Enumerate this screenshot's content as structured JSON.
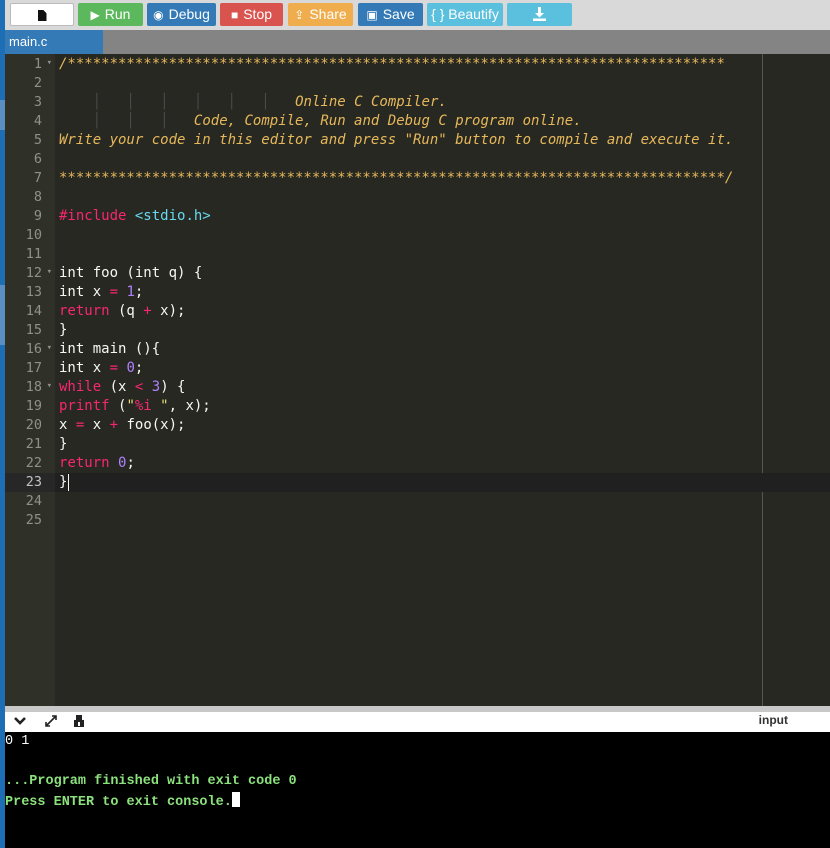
{
  "toolbar": {
    "run_label": "Run",
    "debug_label": "Debug",
    "stop_label": "Stop",
    "share_label": "Share",
    "save_label": "Save",
    "beautify_label": "{ } Beautify",
    "icons": {
      "new": "file-icon",
      "run": "play-icon",
      "debug": "debug-icon",
      "stop": "stop-icon",
      "share": "share-icon",
      "save": "floppy-icon",
      "download": "download-icon"
    }
  },
  "tabs": [
    {
      "label": "main.c",
      "active": true
    }
  ],
  "editor": {
    "line_numbers": [
      "1",
      "2",
      "3",
      "4",
      "5",
      "6",
      "7",
      "8",
      "9",
      "10",
      "11",
      "12",
      "13",
      "14",
      "15",
      "16",
      "17",
      "18",
      "19",
      "20",
      "21",
      "22",
      "23",
      "24",
      "25"
    ],
    "fold_lines": [
      "1",
      "12",
      "16",
      "18"
    ],
    "active_line": "23",
    "lines": [
      "/******************************************************************************",
      "",
      "                            Online C Compiler.",
      "                Code, Compile, Run and Debug C program online.",
      "Write your code in this editor and press \"Run\" button to compile and execute it.",
      "",
      "*******************************************************************************/",
      "",
      "#include <stdio.h>",
      "",
      "",
      "int foo (int q) {",
      "int x = 1;",
      "return (q + x);",
      "}",
      "int main (){",
      "int x = 0;",
      "while (x < 3) {",
      "printf (\"%i \", x);",
      "x = x + foo(x);",
      "}",
      "return 0;",
      "}",
      "",
      ""
    ]
  },
  "console": {
    "input_label": "input",
    "output_line": "0 1",
    "finish_line": "...Program finished with exit code 0",
    "press_line": "Press ENTER to exit console.",
    "icons": [
      "chevron-down-icon",
      "expand-icon",
      "clear-console-icon"
    ]
  },
  "colors": {
    "run": "#5cb85c",
    "debug": "#337ab7",
    "stop": "#d9534f",
    "share": "#f0ad4e",
    "save": "#337ab7",
    "beautify": "#5bc0de",
    "editor_bg": "#272822",
    "comment": "#e6b85b",
    "keyword": "#f92672",
    "number": "#ae81ff",
    "console_text": "#8be17c"
  }
}
